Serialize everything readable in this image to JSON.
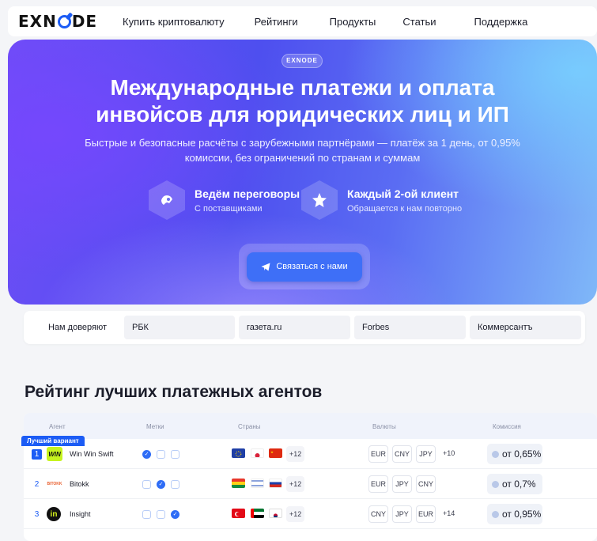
{
  "nav": {
    "logo": "EXNODE",
    "links": [
      "Купить криптовалюту",
      "Рейтинги",
      "Продукты",
      "Статьи",
      "Поддержка"
    ]
  },
  "hero": {
    "badge": "EXNODE",
    "title_line1": "Международные платежи и оплата",
    "title_line2": "инвойсов для юридических лиц и ИП",
    "subtitle_line1": "Быстрые и безопасные расчёты с зарубежными партнёрами — платёж за 1 день, от 0,95%",
    "subtitle_line2": "комиссии, без ограничений по странам и суммам",
    "features": [
      {
        "title": "Ведём переговоры",
        "subtitle": "С поставщиками"
      },
      {
        "title": "Каждый 2-ой клиент",
        "subtitle": "Обращается к нам повторно"
      }
    ],
    "cta_label": "Связаться с нами"
  },
  "trust": {
    "label": "Нам доверяют",
    "items": [
      "РБК",
      "газета.ru",
      "Forbes",
      "Коммерсантъ"
    ]
  },
  "rating": {
    "title": "Рейтинг лучших платежных агентов",
    "columns": [
      "Агент",
      "Метки",
      "Страны",
      "Валюты",
      "Комиссия"
    ],
    "best_label": "Лучший вариант",
    "rows": [
      {
        "rank": "1",
        "logo_text": "WIN",
        "name": "Win Win Swift",
        "more_countries": "+12",
        "currencies": [
          "EUR",
          "CNY",
          "JPY"
        ],
        "more_currencies": "+10",
        "commission": "от 0,65%"
      },
      {
        "rank": "2",
        "logo_text": "BITOKK",
        "name": "Bitokk",
        "more_countries": "+12",
        "currencies": [
          "EUR",
          "JPY",
          "CNY"
        ],
        "more_currencies": "",
        "commission": "от 0,7%"
      },
      {
        "rank": "3",
        "logo_text": "in",
        "name": "Insight",
        "more_countries": "+12",
        "currencies": [
          "CNY",
          "JPY",
          "EUR"
        ],
        "more_currencies": "+14",
        "commission": "от 0,95%"
      }
    ]
  },
  "colors": {
    "accent": "#1c5cf5",
    "cta": "#3e6ff7"
  }
}
